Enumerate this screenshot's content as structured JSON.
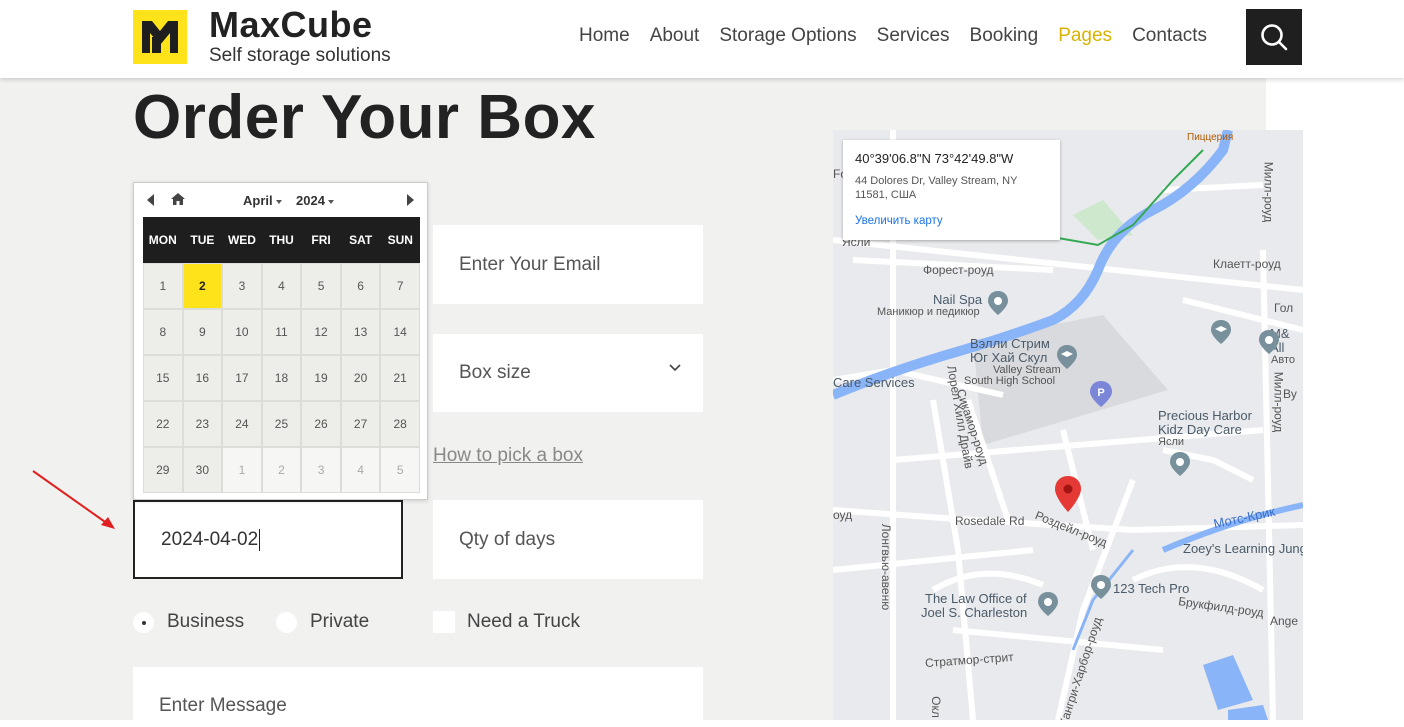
{
  "brand": {
    "name": "MaxCube",
    "tagline": "Self storage solutions",
    "logo_color": "#ffe31a"
  },
  "nav": {
    "items": [
      "Home",
      "About",
      "Storage Options",
      "Services",
      "Booking",
      "Pages",
      "Contacts"
    ],
    "active": "Pages",
    "active_color": "#d9b300"
  },
  "page": {
    "title": "Order Your Box"
  },
  "form": {
    "email_placeholder": "Enter Your Email",
    "box_size_label": "Box size",
    "how_to_link": "How to pick a box",
    "date_value": "2024-04-02",
    "qty_placeholder": "Qty of days",
    "radio_business": "Business",
    "radio_private": "Private",
    "radio_selected": "Business",
    "truck_label": "Need a Truck",
    "message_placeholder": "Enter Message"
  },
  "calendar": {
    "month": "April",
    "year": "2024",
    "weekdays": [
      "MON",
      "TUE",
      "WED",
      "THU",
      "FRI",
      "SAT",
      "SUN"
    ],
    "days": [
      "1",
      "2",
      "3",
      "4",
      "5",
      "6",
      "7",
      "8",
      "9",
      "10",
      "11",
      "12",
      "13",
      "14",
      "15",
      "16",
      "17",
      "18",
      "19",
      "20",
      "21",
      "22",
      "23",
      "24",
      "25",
      "26",
      "27",
      "28",
      "29",
      "30",
      "1",
      "2",
      "3",
      "4",
      "5"
    ],
    "selected_day": "2",
    "highlight_color": "#ffe31a"
  },
  "map": {
    "info": {
      "coords": "40°39'06.8\"N 73°42'49.8\"W",
      "address_line1": "44 Dolores Dr, Valley Stream, NY",
      "address_line2": "11581, США",
      "zoom_link": "Увеличить карту"
    },
    "labels": {
      "pizzeria": "Пиццерия",
      "forest_road": "Форест-роуд",
      "nail_spa": "Nail Spa",
      "nail_spa_sub": "Маникюр и педикюр",
      "school_ru1": "Вэлли Стрим",
      "school_ru2": "Юг Хай Скул",
      "school_en1": "Valley Stream",
      "school_en2": "South High School",
      "care_services": "Care Services",
      "sycamore": "Сикамор-роуд",
      "laurel": "Лорел Хилл Драйв",
      "precious1": "Precious Harbor",
      "precious2": "Kidz Day Care",
      "precious3": "Ясли",
      "rosedale": "Rosedale Rd",
      "roseday": "Роздейл-роуд",
      "motts": "Мотс-Крик",
      "zoey": "Zoey's Learning Jung",
      "tech": "123 Tech Pro",
      "law1": "The Law Office of",
      "law2": "Joel S. Charleston",
      "brookfield": "Брукфилд-роуд",
      "angel": "Ange",
      "stratmore": "Стратмор-стрит",
      "hungry": "Хангри-Харбор-роуд",
      "mill": "Милл-роуд",
      "claret": "Клаетт-роуд",
      "yasli": "Ясли",
      "road_left": "оуд",
      "long": "Лонгвью-авеню",
      "m_and": "M&",
      "all": "All",
      "auto": "Авто",
      "gol": "Гол",
      "vu": "Ву",
      "f": "Fo",
      "ok": "Окл"
    }
  }
}
